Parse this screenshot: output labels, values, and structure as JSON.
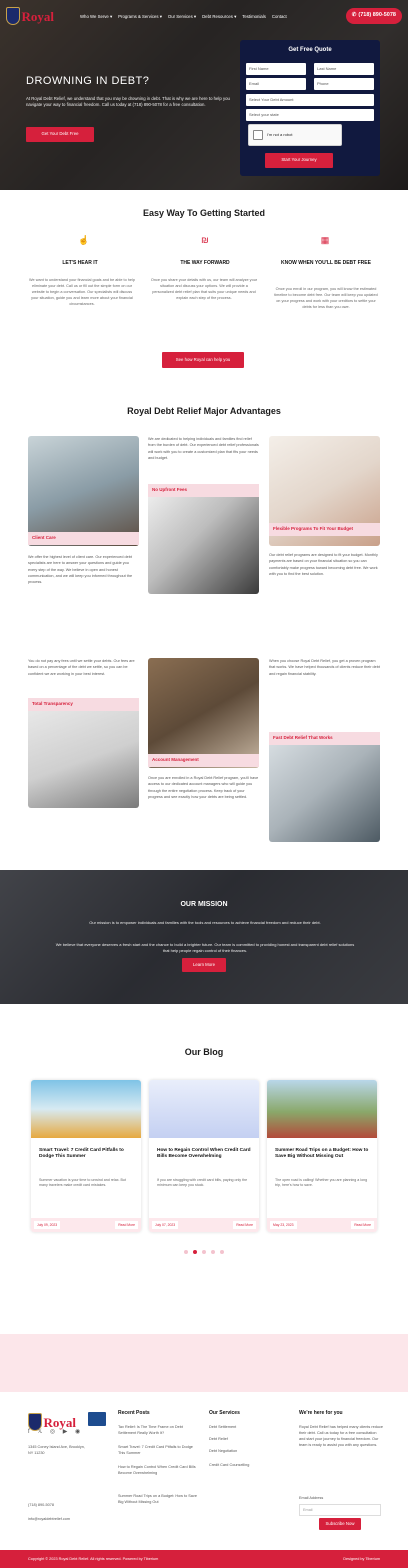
{
  "brand": {
    "name": "Royal",
    "accent": "#d6203c",
    "navy": "#11193f",
    "pink": "#fce6ea"
  },
  "nav": {
    "items": [
      "Who We Serve ▾",
      "Programs & Services ▾",
      "Our Services ▾",
      "Debt Resources ▾",
      "Testimonials",
      "Contact"
    ],
    "phone": "(718) 890-5078"
  },
  "hero": {
    "title": "DROWNING IN DEBT?",
    "text": "At Royal Debt Relief, we understand that you may be drowning in debt. That is why we are here to help you navigate your way to financial freedom. Call us today at (718) 890-5078 for a free consultation.",
    "cta": "Get Your Debt Free"
  },
  "quote": {
    "title": "Get Free Quote",
    "first": "First Name",
    "last": "Last Name",
    "email": "Email",
    "phone": "Phone",
    "debt": "Select Your Debt Amount",
    "state": "Select your state",
    "captcha": "I'm not a robot",
    "submit": "Start Your Journey"
  },
  "steps": {
    "title": "Easy Way To Getting Started",
    "items": [
      {
        "heading": "LET'S HEAR IT",
        "text": "We want to understand your financial goals and be able to help eliminate your debt. Call us or fill out the simple form on our website to begin a conversation. Our specialists will discuss your situation, guide you and learn more about your financial circumstances."
      },
      {
        "heading": "THE WAY FORWARD",
        "text": "Once you share your details with us, our team will analyze your situation and discuss your options. We will provide a personalized debt relief plan that suits your unique needs and explain each step of the process."
      },
      {
        "heading": "KNOW WHEN YOU'LL BE DEBT FREE",
        "text": "Once you enroll in our program, you will know the estimated timeline to become debt free. Our team will keep you updated on your progress and work with your creditors to settle your debts for less than you owe."
      }
    ],
    "cta": "See how Royal can help you"
  },
  "advantages": {
    "title": "Royal Debt Relief Major Advantages",
    "intro_mid": "We are dedicated to helping individuals and families find relief from the burden of debt. Our experienced debt relief professionals will work with you to create a customized plan that fits your needs and budget.",
    "client_care": {
      "tag": "Client Care",
      "text": "We offer the highest level of client care. Our experienced debt specialists are here to answer your questions and guide you every step of the way. We believe in open and honest communication, and we will keep you informed throughout the process."
    },
    "no_upfront": {
      "tag": "No Upfront Fees"
    },
    "flexible": {
      "tag": "Flexible Programs To Fit Your Budget",
      "text": "Our debt relief programs are designed to fit your budget. Monthly payments are based on your financial situation so you can comfortably make progress toward becoming debt free. We work with you to find the best solution."
    },
    "left_text": "You do not pay any fees until we settle your debts. Our fees are based on a percentage of the debt we settle, so you can be confident we are working in your best interest.",
    "transparency": {
      "tag": "Total Transparency"
    },
    "account": {
      "tag": "Account Management",
      "text": "Once you are enrolled in a Royal Debt Relief program, you'll have access to our dedicated account managers who will guide you through the entire negotiation process. Keep track of your progress and see exactly how your debts are being settled."
    },
    "right_text": "When you choose Royal Debt Relief, you get a proven program that works. We have helped thousands of clients reduce their debt and regain financial stability.",
    "fast": {
      "tag": "Fast Debt Relief That Works"
    }
  },
  "mission": {
    "title": "OUR MISSION",
    "text1": "Our mission is to empower individuals and families with the tools and resources to achieve financial freedom and reduce their debt.",
    "text2": "We believe that everyone deserves a fresh start and the chance to build a brighter future. Our team is committed to providing honest and transparent debt relief solutions that help people regain control of their finances.",
    "cta": "Learn More"
  },
  "blog": {
    "title": "Our Blog",
    "posts": [
      {
        "title": "Smart Travel: 7 Credit Card Pitfalls to Dodge This Summer",
        "excerpt": "Summer vacation is your time to unwind and relax. But many travelers make credit card mistakes.",
        "date": "July 09, 2023",
        "read": "Read More"
      },
      {
        "title": "How to Regain Control When Credit Card Bills Become Overwhelming",
        "excerpt": "If you are struggling with credit card bills, paying only the minimum can keep you stuck.",
        "date": "July 07, 2023",
        "read": "Read More"
      },
      {
        "title": "Summer Road Trips on a Budget: How to Save Big Without Missing Out",
        "excerpt": "The open road is calling! Whether you are planning a long trip, here's how to save.",
        "date": "May 23, 2023",
        "read": "Read More"
      }
    ]
  },
  "footer": {
    "address": "1345 Coney Island Ave, Brooklyn, NY 11230",
    "phone": "(718) 890-5078",
    "email": "info@royaldebtrelief.com",
    "recent_h": "Recent Posts",
    "recent": [
      "Tax Relief: Is The Time Frame on Debt Settlement Really Worth It?",
      "Smart Travel: 7 Credit Card Pitfalls to Dodge This Summer",
      "How to Regain Control When Credit Card Bills Become Overwhelming",
      "Summer Road Trips on a Budget: How to Save Big Without Missing Out"
    ],
    "services_h": "Our Services",
    "services": [
      "Debt Settlement",
      "Debt Relief",
      "Debt Negotiation",
      "Credit Card Counselling"
    ],
    "help_h": "We're here for you",
    "help_text": "Royal Debt Relief has helped many clients reduce their debt. Call us today for a free consultation and start your journey to financial freedom. Our team is ready to assist you with any questions.",
    "email_label": "Email Address",
    "email_ph": "Email",
    "subscribe": "Subscribe Now",
    "copyright": "Copyright © 2023 Royal Debt Relief. All rights reserved. Powered by Tiberium",
    "designed": "Designed by Tiberium"
  }
}
